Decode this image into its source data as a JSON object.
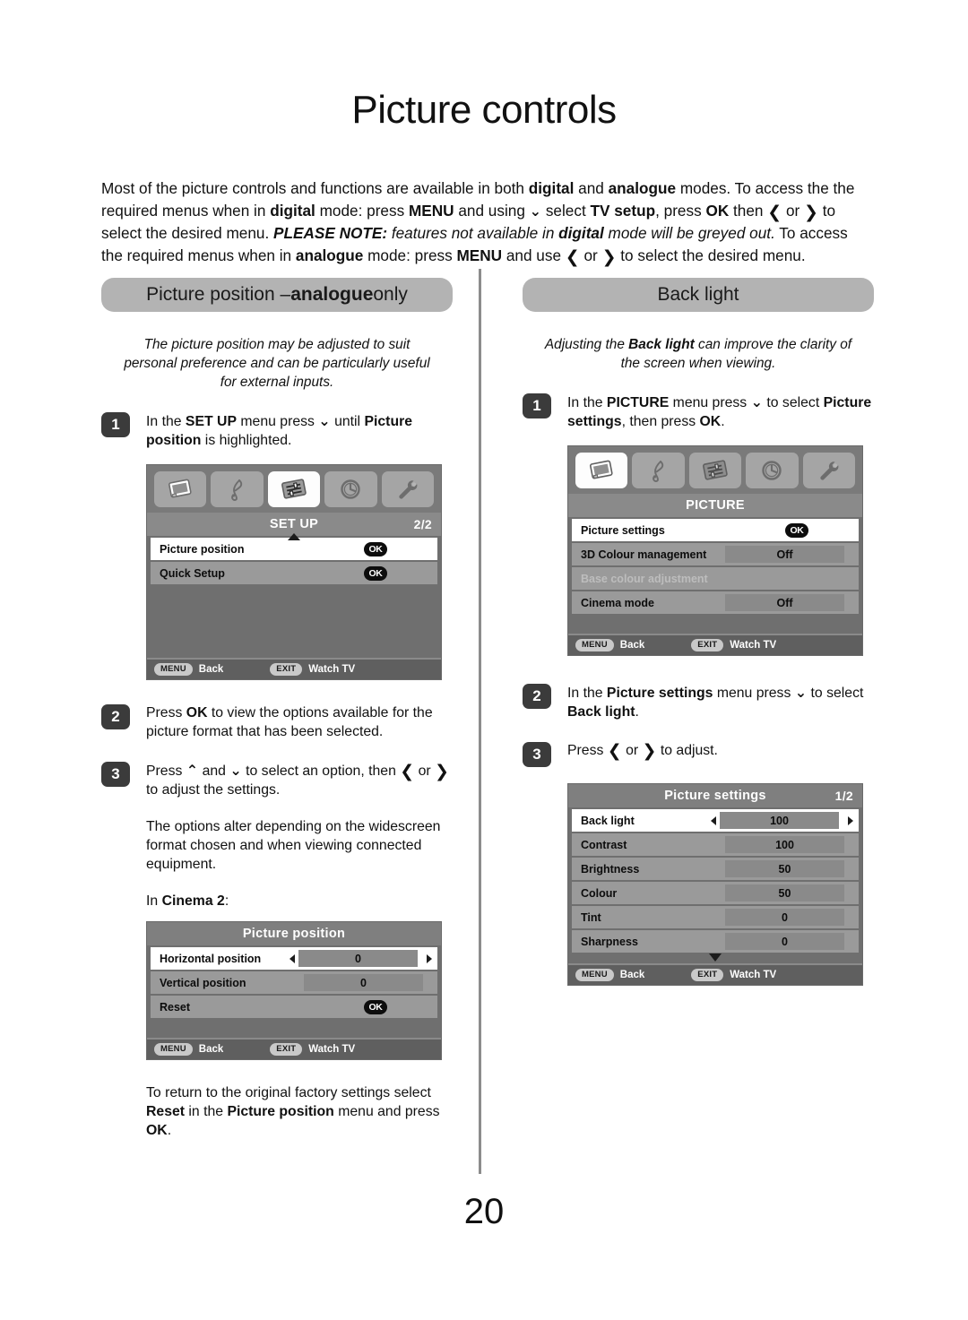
{
  "document": {
    "title": "Picture controls",
    "page_number": "20",
    "intro": {
      "line1_a": "Most of the picture controls and functions are available in both ",
      "b_digital": "digital",
      "line1_b": " and ",
      "b_analogue": "analogue",
      "line1_c": " modes. To access the the required menus when in ",
      "b_digital2": "digital",
      "line1_d": " mode: press ",
      "b_menu": "MENU",
      "line1_e": " and using ",
      "arrow_down": "⌄",
      "line1_f": " select ",
      "b_tvsetup": "TV setup",
      "line1_g": ", press ",
      "b_ok": "OK",
      "line1_h": " then ",
      "arrow_left": "❮",
      "line1_i": " or ",
      "arrow_right": "❯",
      "line1_j": " to select the desired menu. ",
      "i_note_head": "PLEASE NOTE:",
      "i_note_a": " features not available in ",
      "i_note_digital": "digital",
      "i_note_b": " mode will be greyed out.",
      "line1_k": " To access the required menus when in ",
      "b_analogue2": "analogue",
      "line1_l": " mode: press ",
      "b_menu2": "MENU",
      "line1_m": " and use ",
      "line1_n": " or ",
      "line1_o": " to select the desired menu."
    }
  },
  "left_column": {
    "header_a": "Picture position – ",
    "header_b": "analogue",
    "header_c": " only",
    "lead": "The picture position may be adjusted to suit personal preference and can be particularly useful for external inputs.",
    "steps": [
      {
        "number": "1",
        "text_a": "In the ",
        "bold_1": "SET UP",
        "text_b": " menu press ",
        "arrow": "⌄",
        "text_c": " until ",
        "bold_2": "Picture position",
        "text_d": " is highlighted."
      },
      {
        "number": "2",
        "text_a": "Press ",
        "bold_1": "OK",
        "text_b": " to view the options available for the picture format that has been selected."
      },
      {
        "number": "3",
        "text_a": "Press ",
        "arrow_up": "⌃",
        "text_b": " and ",
        "arrow_down": "⌄",
        "text_c": " to select an option, then ",
        "arrow_left": "❮",
        "text_d": " or ",
        "arrow_right": "❯",
        "text_e": " to adjust the settings."
      }
    ],
    "note_options": "The options alter depending on the widescreen format chosen and when viewing connected equipment.",
    "cinema_label_a": "In ",
    "cinema_label_b": "Cinema 2",
    "cinema_label_c": ":",
    "reset_note_a": "To return to the original factory settings select ",
    "reset_note_bold1": "Reset",
    "reset_note_b": " in the ",
    "reset_note_bold2": "Picture position",
    "reset_note_c": " menu and press ",
    "reset_note_bold3": "OK",
    "reset_note_d": "."
  },
  "right_column": {
    "header": "Back light",
    "lead_a": "Adjusting the ",
    "lead_bold": "Back light",
    "lead_b": " can improve the clarity of the screen when viewing.",
    "steps": [
      {
        "number": "1",
        "text_a": "In the ",
        "bold_1": "PICTURE",
        "text_b": " menu press ",
        "arrow": "⌄",
        "text_c": " to select ",
        "bold_2": "Picture settings",
        "text_d": ", then press ",
        "bold_3": "OK",
        "text_e": "."
      },
      {
        "number": "2",
        "text_a": "In the ",
        "bold_1": "Picture settings",
        "text_b": " menu press ",
        "arrow": "⌄",
        "text_c": " to select ",
        "bold_2": "Back light",
        "text_d": "."
      },
      {
        "number": "3",
        "text_a": "Press ",
        "arrow_left": "❮",
        "text_b": " or ",
        "arrow_right": "❯",
        "text_c": " to adjust."
      }
    ]
  },
  "osd_common": {
    "footer_menu_key": "MENU",
    "footer_menu_label": "Back",
    "footer_exit_key": "EXIT",
    "footer_exit_label": "Watch TV",
    "ok_badge": "OK",
    "icons": [
      "picture-icon",
      "sound-icon",
      "setup-icon",
      "clock-icon",
      "tools-icon"
    ]
  },
  "osd_setup": {
    "title": "SET UP",
    "page_indicator": "2/2",
    "active_icon_index": 2,
    "rows": [
      {
        "label": "Picture position",
        "value": "OK",
        "type": "ok",
        "state": "selected"
      },
      {
        "label": "Quick Setup",
        "value": "OK",
        "type": "ok",
        "state": "normal"
      }
    ]
  },
  "osd_picture_position": {
    "title": "Picture position",
    "page_indicator": "",
    "rows": [
      {
        "label": "Horizontal position",
        "value": "0",
        "type": "adjust",
        "state": "selected"
      },
      {
        "label": "Vertical position",
        "value": "0",
        "type": "value",
        "state": "normal"
      },
      {
        "label": "Reset",
        "value": "OK",
        "type": "ok",
        "state": "normal"
      }
    ]
  },
  "osd_picture": {
    "title": "PICTURE",
    "page_indicator": "",
    "active_icon_index": 0,
    "rows": [
      {
        "label": "Picture settings",
        "value": "OK",
        "type": "ok",
        "state": "selected"
      },
      {
        "label": "3D Colour management",
        "value": "Off",
        "type": "value",
        "state": "normal"
      },
      {
        "label": "Base colour adjustment",
        "value": "",
        "type": "none",
        "state": "disabled"
      },
      {
        "label": "Cinema mode",
        "value": "Off",
        "type": "value",
        "state": "normal"
      }
    ]
  },
  "osd_picture_settings": {
    "title": "Picture settings",
    "page_indicator": "1/2",
    "rows": [
      {
        "label": "Back light",
        "value": "100",
        "type": "adjust",
        "state": "selected"
      },
      {
        "label": "Contrast",
        "value": "100",
        "type": "value",
        "state": "normal"
      },
      {
        "label": "Brightness",
        "value": "50",
        "type": "value",
        "state": "normal"
      },
      {
        "label": "Colour",
        "value": "50",
        "type": "value",
        "state": "normal"
      },
      {
        "label": "Tint",
        "value": "0",
        "type": "value",
        "state": "normal"
      },
      {
        "label": "Sharpness",
        "value": "0",
        "type": "value",
        "state": "normal"
      }
    ]
  }
}
